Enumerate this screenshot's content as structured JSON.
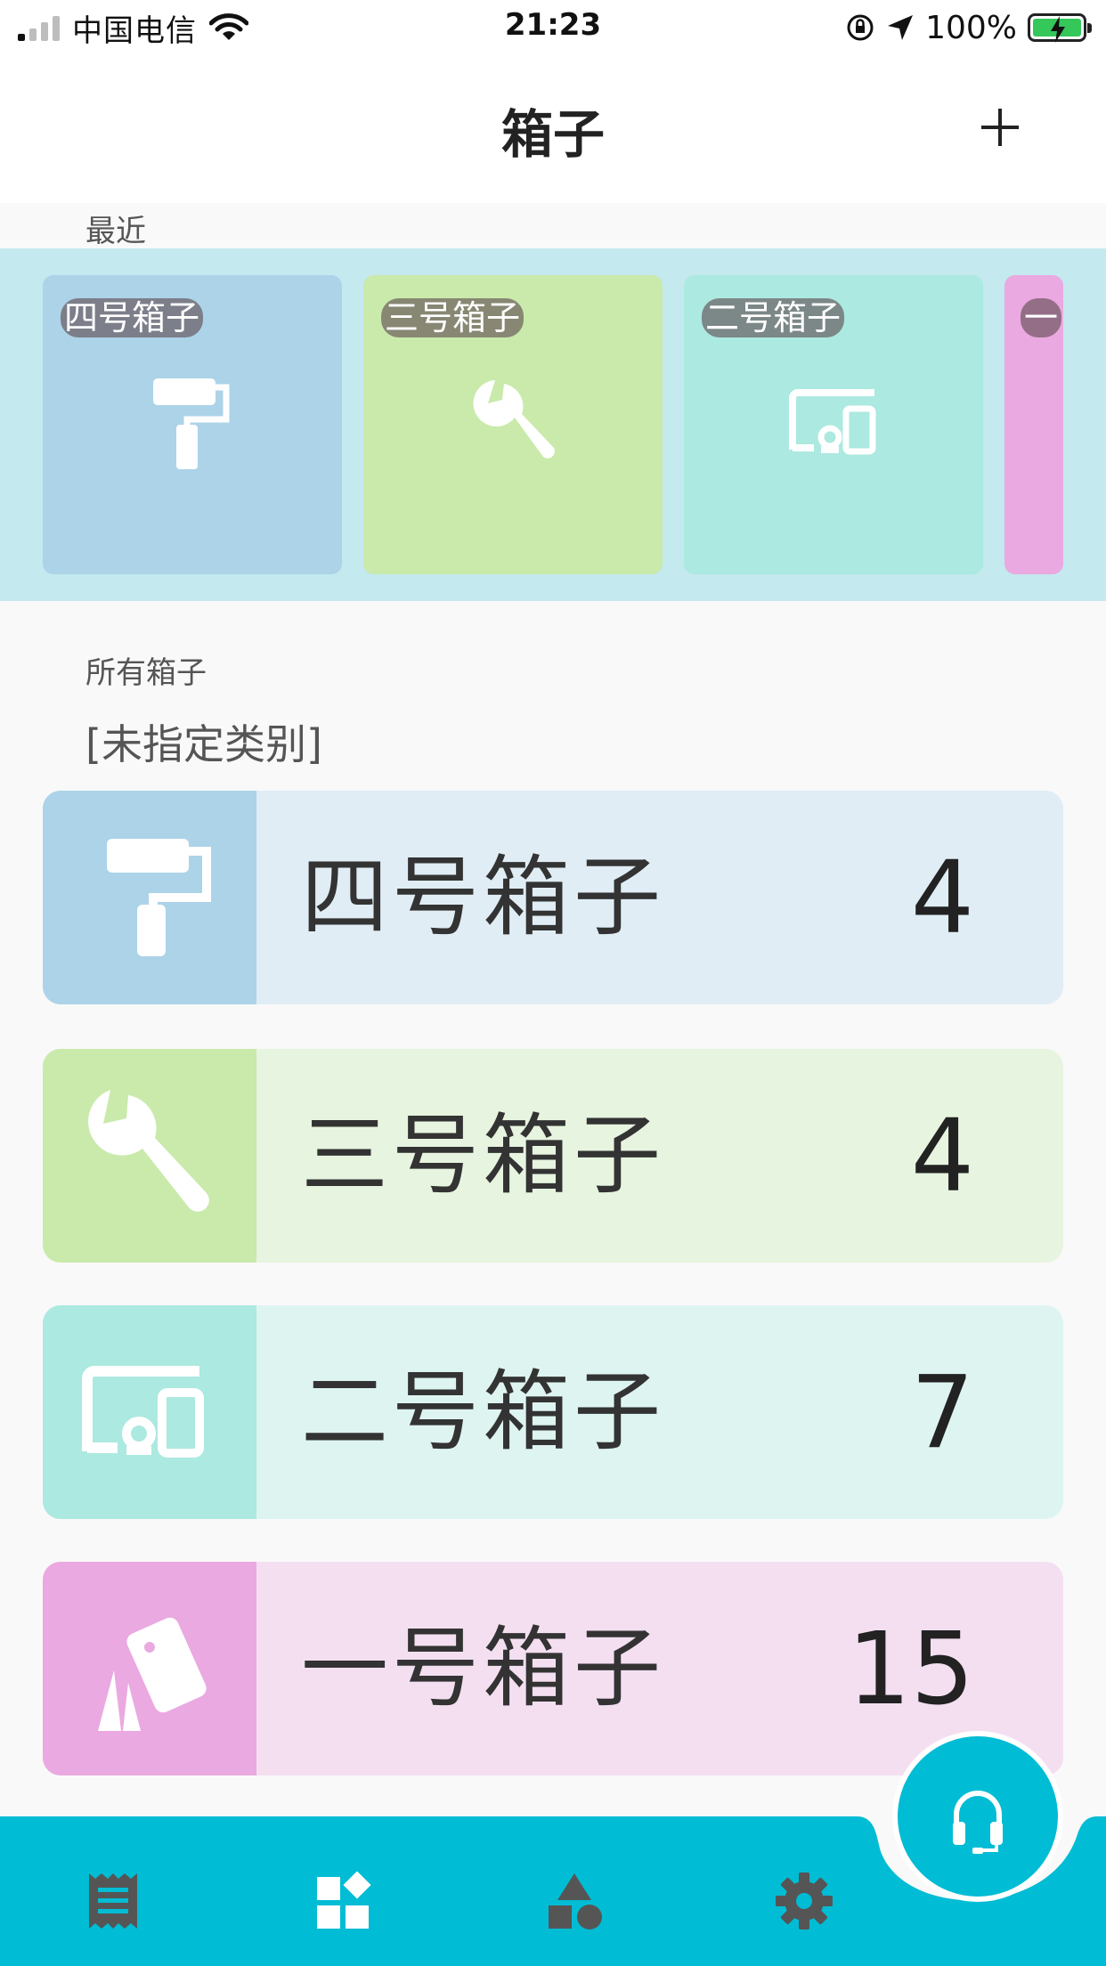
{
  "status_bar": {
    "carrier": "中国电信",
    "time": "21:23",
    "battery": "100%"
  },
  "nav": {
    "title": "箱子",
    "add_label": "+"
  },
  "recent": {
    "label": "最近",
    "items": [
      {
        "label": "四号箱子",
        "icon": "paint-roller-icon",
        "color": "#acd3e8"
      },
      {
        "label": "三号箱子",
        "icon": "wrench-icon",
        "color": "#c9eaab"
      },
      {
        "label": "二号箱子",
        "icon": "devices-icon",
        "color": "#ace9e0"
      },
      {
        "label": "一",
        "icon": "cards-icon",
        "color": "#eaa9e0"
      }
    ]
  },
  "all_boxes": {
    "label": "所有箱子",
    "category": "[未指定类别]",
    "items": [
      {
        "name": "四号箱子",
        "count": "4",
        "icon": "paint-roller-icon",
        "icon_bg": "#acd3e8",
        "row_bg": "#e0edf5"
      },
      {
        "name": "三号箱子",
        "count": "4",
        "icon": "wrench-icon",
        "icon_bg": "#c9eaab",
        "row_bg": "#e7f4df"
      },
      {
        "name": "二号箱子",
        "count": "7",
        "icon": "devices-icon",
        "icon_bg": "#ace9e0",
        "row_bg": "#def4f1"
      },
      {
        "name": "一号箱子",
        "count": "15",
        "icon": "cards-icon",
        "icon_bg": "#eaa9e0",
        "row_bg": "#f4dff1"
      }
    ]
  },
  "tab_bar": {
    "accent": "#00bcd4",
    "icon_color": "#555555",
    "tabs": [
      {
        "icon": "receipt-icon"
      },
      {
        "icon": "widgets-icon"
      },
      {
        "icon": "shapes-icon"
      },
      {
        "icon": "settings-gear-icon"
      }
    ],
    "fab_icon": "headset-icon"
  }
}
